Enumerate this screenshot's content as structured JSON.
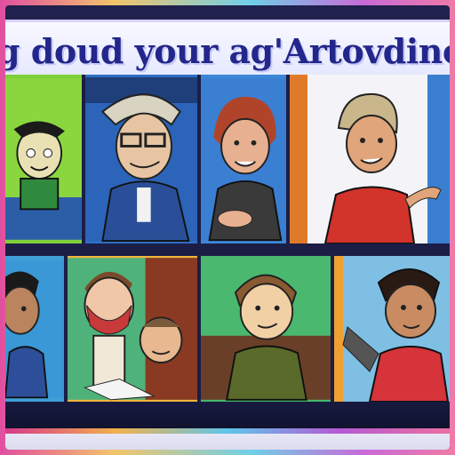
{
  "banner": {
    "title": "g doud your ag'Artovdinonbor"
  },
  "colors": {
    "title_text": "#23268a",
    "frame_accent_1": "#e14fa0",
    "frame_accent_2": "#6fd0e8",
    "background": "#20214d"
  },
  "panels_top": [
    {
      "name": "panel-green-character",
      "bg": "#7fcf3a"
    },
    {
      "name": "panel-man-with-glasses",
      "bg": "#2e6fc4"
    },
    {
      "name": "panel-woman-red-hair",
      "bg": "#3d86d8"
    },
    {
      "name": "panel-woman-red-top",
      "bg": "#5aa9e4"
    }
  ],
  "panels_bottom": [
    {
      "name": "panel-boy-dark-hair",
      "bg": "#3fa0d8"
    },
    {
      "name": "panel-two-men",
      "bg": "#f2b43a"
    },
    {
      "name": "panel-smiling-person",
      "bg": "#46b86b"
    },
    {
      "name": "panel-girl-red-shirt",
      "bg": "#f0a030"
    }
  ]
}
